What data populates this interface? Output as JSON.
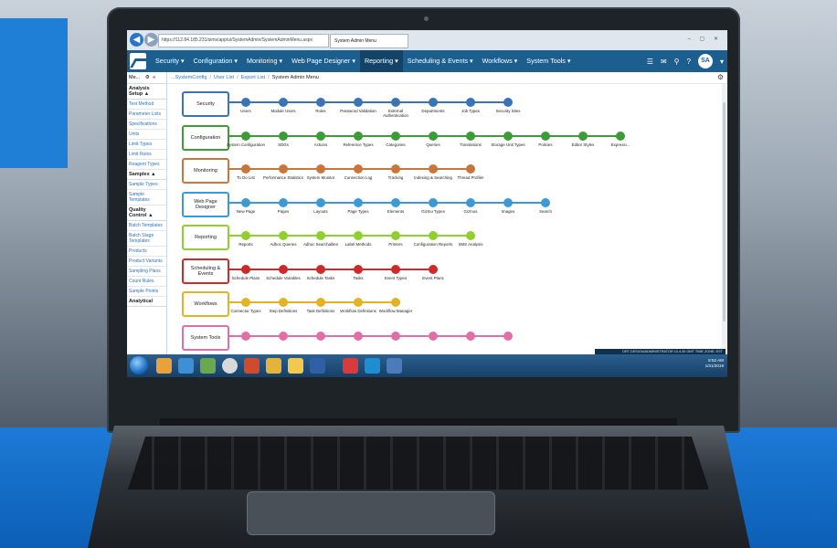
{
  "browser": {
    "url": "https://112.84.185.231/sims/app/ui/SystemAdmin/SystemAdminMenu.aspx",
    "tab_title": "System Admin Menu"
  },
  "nav": {
    "menu": [
      "Security",
      "Configuration",
      "Monitoring",
      "Web Page Designer",
      "Reporting",
      "Scheduling & Events",
      "Workflows",
      "System Tools"
    ],
    "active": "Reporting",
    "avatar": "SA"
  },
  "sidebar": {
    "top_label": "Me...",
    "groups": [
      {
        "title": "Analysis Setup ▲",
        "items": [
          "Test Method",
          "Parameter Lists",
          "Specifications",
          "Units",
          "Limit Types",
          "Limit Rules",
          "Reagent Types"
        ]
      },
      {
        "title": "Samples ▲",
        "items": [
          "Sample Types",
          "Sample Templates"
        ]
      },
      {
        "title": "Quality Control ▲",
        "items": [
          "Batch Templates",
          "Batch Stage Templates",
          "Products",
          "Product Variants",
          "Sampling Plans",
          "Count Rules",
          "Sample Points"
        ]
      },
      {
        "title": "Analytical",
        "items": []
      }
    ]
  },
  "breadcrumb": {
    "items": [
      "...SystemConfig",
      "User List",
      "Export List"
    ],
    "current": "System Admin Menu"
  },
  "rows": [
    {
      "category": "Security",
      "color": "#3a74b4",
      "nodes": [
        "Users",
        "Module Users",
        "Roles",
        "Password Validation",
        "External Authentication",
        "Departments",
        "Job Types",
        "Security Sites"
      ]
    },
    {
      "category": "Configuration",
      "color": "#3e9b3a",
      "nodes": [
        "System Configuration",
        "SDGs",
        "Actions",
        "Reference Types",
        "Categories",
        "Queries",
        "Translations",
        "Storage Unit Types",
        "Policies",
        "Editor Styles",
        "Expressi..."
      ]
    },
    {
      "category": "Monitoring",
      "color": "#c8763a",
      "nodes": [
        "To Do List",
        "Performance Statistics",
        "System Monitor",
        "Connection Log",
        "Tracking",
        "Indexing & Searching",
        "Thread Profiler"
      ]
    },
    {
      "category": "Web Page Designer",
      "color": "#3b9ad6",
      "nodes": [
        "New Page",
        "Pages",
        "Layouts",
        "Page Types",
        "Elements",
        "Gizmo Types",
        "Gizmos",
        "Images",
        "Search"
      ]
    },
    {
      "category": "Reporting",
      "color": "#8fcf2e",
      "nodes": [
        "Reports",
        "Adhoc Queries",
        "Adhoc Searchables",
        "Label Methods",
        "Printers",
        "Configuration Reports",
        "SMS Analysis"
      ]
    },
    {
      "category": "Scheduling & Events",
      "color": "#cc2b2b",
      "nodes": [
        "Schedule Plans",
        "Schedule Variables",
        "Schedule Tasks",
        "Tasks",
        "Event Types",
        "Event Plans"
      ]
    },
    {
      "category": "Workflows",
      "color": "#e2b324",
      "nodes": [
        "Connector Types",
        "Step Definitions",
        "Task Definitions",
        "Workflow Definitions",
        "Workflow Manager"
      ]
    },
    {
      "category": "System Tools",
      "color": "#e06fa8",
      "nodes": [
        "",
        "",
        "",
        "",
        "",
        "",
        "",
        ""
      ]
    }
  ],
  "taskbar": {
    "time": "8:52 AM",
    "date": "1/31/2019",
    "status_strip": "DRT DESIGN/ADMINISTRATOR 10.4.00 GMT TIME ZONE: EST"
  }
}
